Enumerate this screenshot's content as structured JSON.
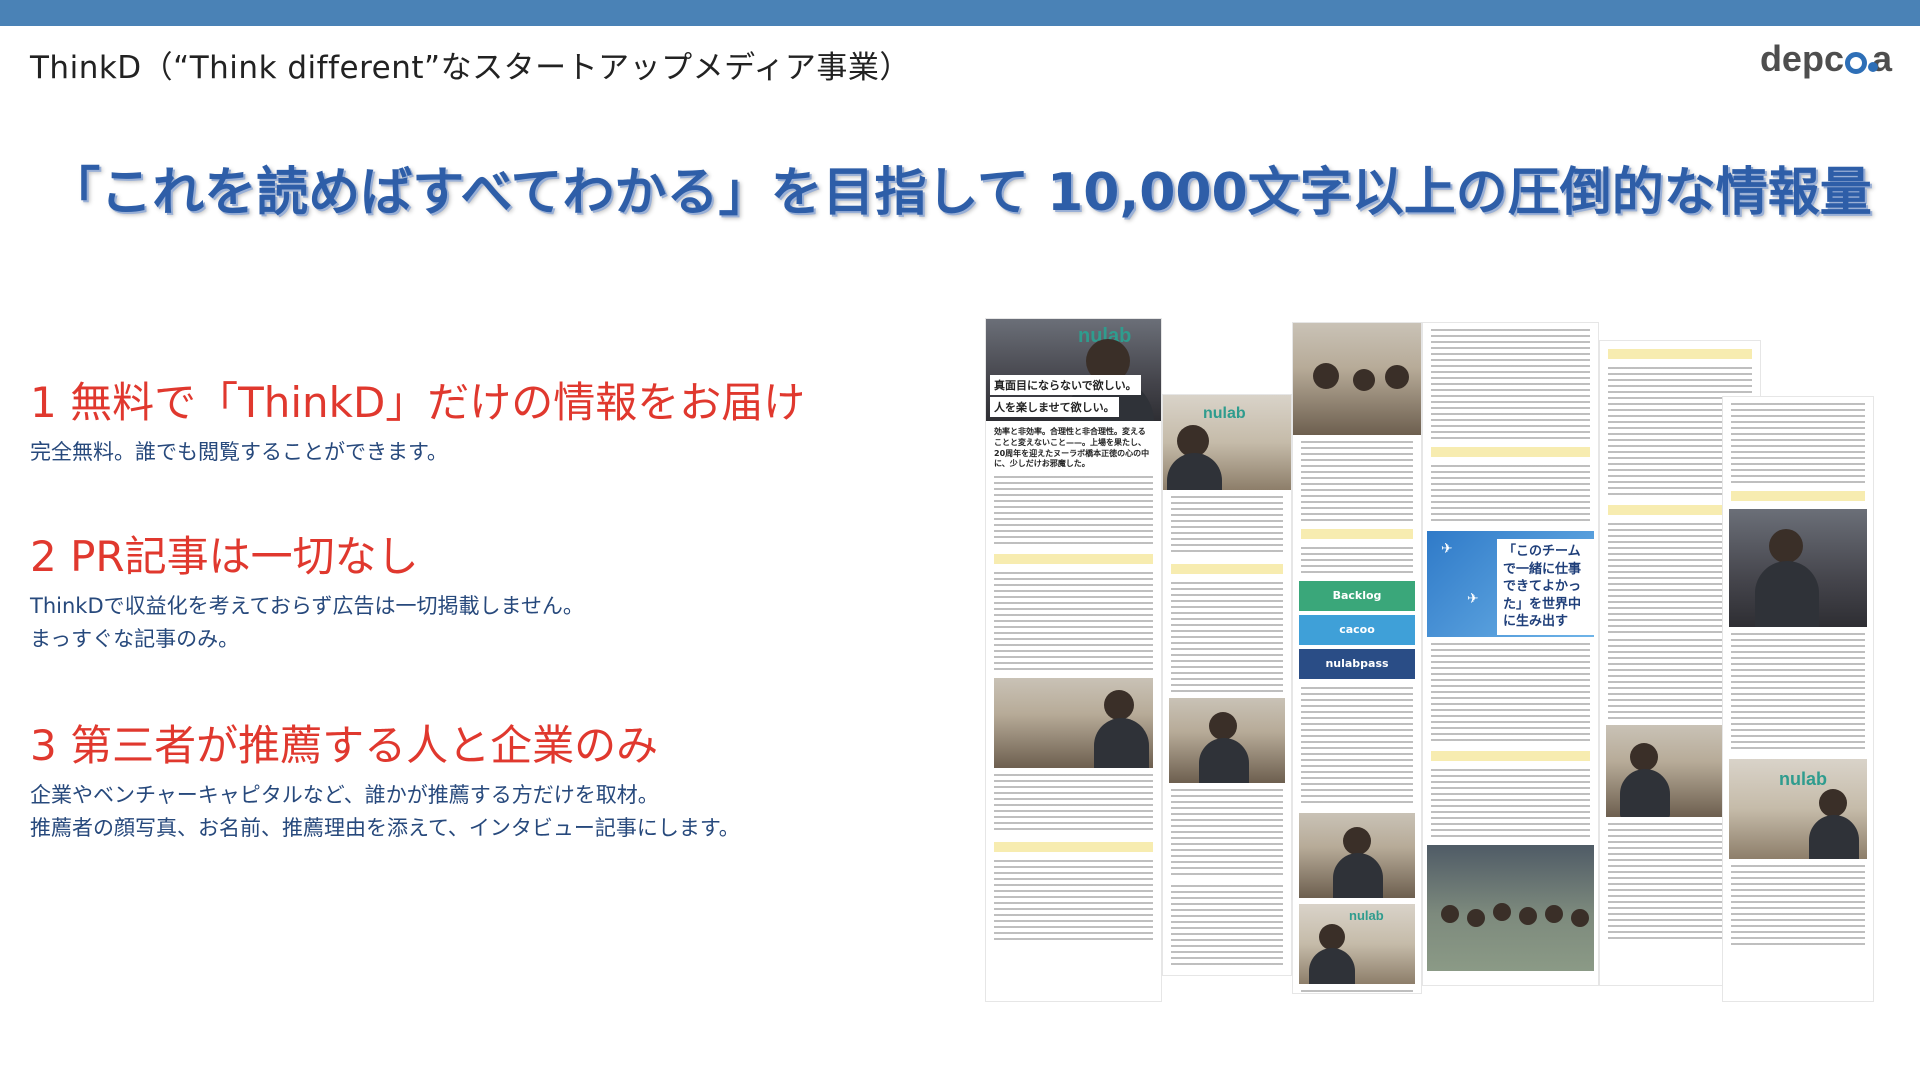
{
  "header": {
    "title": "ThinkD（“Think different”なスタートアップメディア事業）",
    "logo_text_left": "depc",
    "logo_text_right": "a"
  },
  "headline": "「これを読めばすべてわかる」を目指して 10,000文字以上の圧倒的な情報量",
  "points": [
    {
      "title": "1 無料で「ThinkD」だけの情報をお届け",
      "desc": [
        "完全無料。誰でも閲覧することができます。"
      ]
    },
    {
      "title": "2 PR記事は一切なし",
      "desc": [
        "ThinkDで収益化を考えておらず広告は一切掲載しません。",
        "まっすぐな記事のみ。"
      ]
    },
    {
      "title": "3 第三者が推薦する人と企業のみ",
      "desc": [
        "企業やベンチャーキャピタルなど、誰かが推薦する方だけを取材。",
        "推薦者の顔写真、お名前、推薦理由を添えて、インタビュー記事にします。"
      ]
    }
  ],
  "collage": {
    "hero_overlay_1": "真面目にならないで欲しい。",
    "hero_overlay_2": "人を楽しませて欲しい。",
    "article_lead": "効率と非効率。合理性と非合理性。変えることと変えないこと——。上場を果たし、20周年を迎えたヌーラボ橋本正徳の心の中に、少しだけお邪魔した。",
    "nulab_sign": "nulab",
    "card_backlog": "Backlog",
    "card_cacoo": "cacoo",
    "card_nulabpass": "nulabpass",
    "slogan": "「このチームで一緒に仕事できてよかった」を世界中に生み出す",
    "colors": {
      "accent": "#2e5ea8",
      "point_title": "#e0382e",
      "topbar": "#4a82b6"
    }
  }
}
